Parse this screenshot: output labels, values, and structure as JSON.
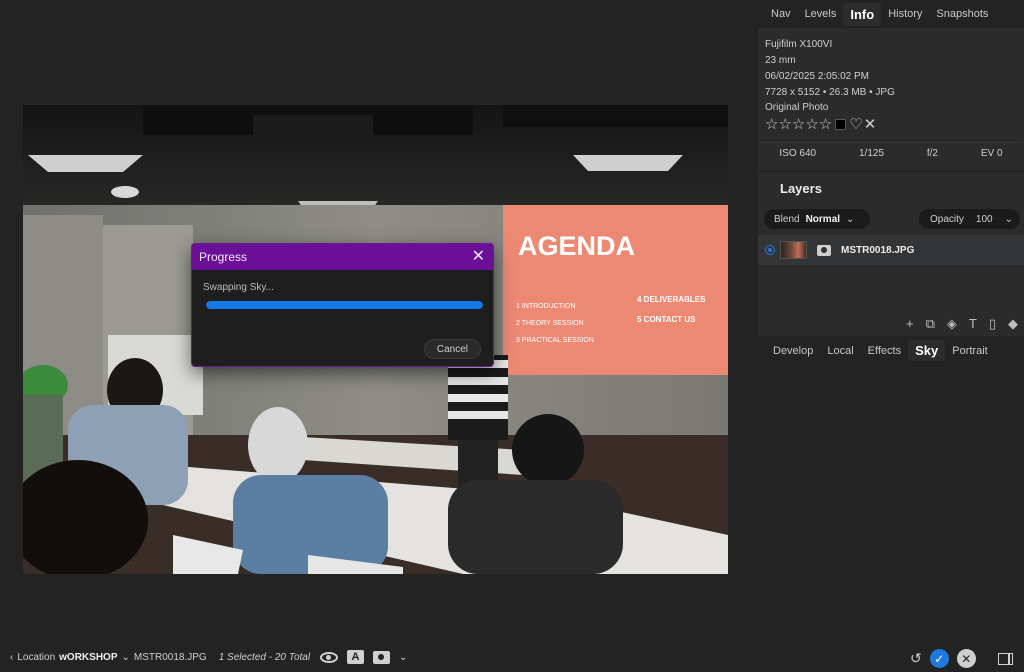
{
  "panel": {
    "tabs_top": [
      "Nav",
      "Levels",
      "Info",
      "History",
      "Snapshots"
    ],
    "active_top_tab": "Info",
    "info": {
      "camera": "Fujifilm X100VI",
      "focal": "23 mm",
      "datetime": "06/02/2025 2:05:02 PM",
      "dims": "7728 x 5152 • 26.3 MB • JPG",
      "status": "Original Photo",
      "stars": "☆☆☆☆☆",
      "heart": "♡",
      "reject": "✕",
      "exif": {
        "iso": "ISO 640",
        "shutter": "1/125",
        "aperture": "f/2",
        "ev": "EV 0"
      }
    },
    "layers": {
      "title": "Layers",
      "blend_label": "Blend",
      "blend_value": "Normal",
      "opacity_label": "Opacity",
      "opacity_value": "100",
      "layer_name": "MSTR0018.JPG",
      "tool_icons": [
        "+",
        "⧉",
        "◈",
        "T",
        "▯",
        "◆"
      ]
    },
    "tool_tabs": [
      "Develop",
      "Local",
      "Effects",
      "Sky",
      "Portrait"
    ],
    "active_tool_tab": "Sky"
  },
  "dialog": {
    "title": "Progress",
    "message": "Swapping Sky...",
    "progress": 1.0,
    "cancel": "Cancel",
    "close": "✕"
  },
  "photo": {
    "screen_title": "AGENDA",
    "screen_items": [
      "1 INTRODUCTION",
      "2 THEORY SESSION",
      "3 PRACTICAL SESSION",
      "4 DELIVERABLES",
      "5 CONTACT US"
    ]
  },
  "bottombar": {
    "back_chevron": "‹",
    "location_label": "Location",
    "folder": "wORKSHOP",
    "chevron": "⌄",
    "file": "MSTR0018.JPG",
    "selection": "1 Selected - 20 Total",
    "a_badge": "A",
    "dropdown": "⌄",
    "undo": "↺",
    "ok": "✓",
    "cancel": "✕"
  },
  "colors": {
    "accent": "#1f7ae0",
    "dialog_title": "#6b0f99",
    "progress": "#1578e8"
  }
}
